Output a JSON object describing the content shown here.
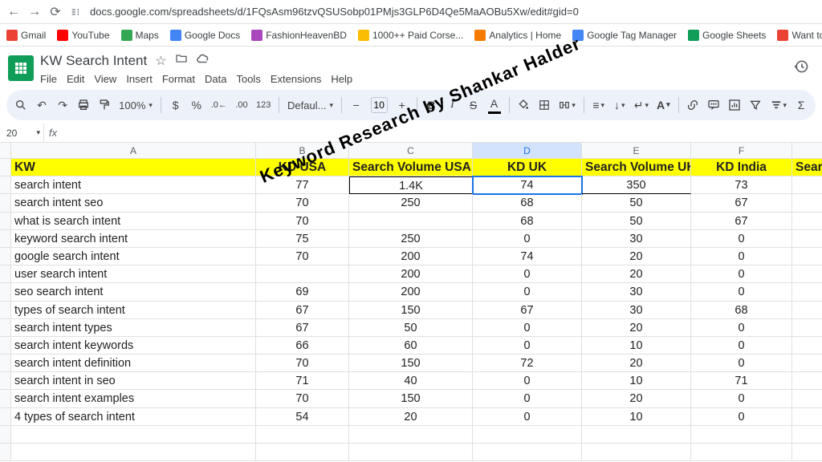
{
  "browser": {
    "url": "docs.google.com/spreadsheets/d/1FQsAsm96tzvQSUSobp01PMjs3GLP6D4Qe5MaAOBu5Xw/edit#gid=0"
  },
  "bookmarks": [
    {
      "label": "Gmail",
      "color": "#ea4335"
    },
    {
      "label": "YouTube",
      "color": "#ff0000"
    },
    {
      "label": "Maps",
      "color": "#34a853"
    },
    {
      "label": "Google Docs",
      "color": "#4285f4"
    },
    {
      "label": "FashionHeavenBD",
      "color": "#ab47bc"
    },
    {
      "label": "1000++ Paid Corse...",
      "color": "#fbbc04"
    },
    {
      "label": "Analytics | Home",
      "color": "#f57c00"
    },
    {
      "label": "Google Tag Manager",
      "color": "#4285f4"
    },
    {
      "label": "Google Sheets",
      "color": "#0f9d58"
    },
    {
      "label": "Want to be a top rat...",
      "color": "#ea4335"
    }
  ],
  "doc": {
    "title": "KW Search Intent",
    "menus": [
      "File",
      "Edit",
      "View",
      "Insert",
      "Format",
      "Data",
      "Tools",
      "Extensions",
      "Help"
    ]
  },
  "toolbar": {
    "zoom": "100%",
    "font": "Defaul...",
    "size": "10"
  },
  "namebox": "20",
  "columns": [
    "",
    "A",
    "B",
    "C",
    "D",
    "E",
    "F",
    ""
  ],
  "header_row": [
    "KW",
    "KD  USA",
    "Search Volume USA",
    "KD UK",
    "Search Volume UK",
    "KD India",
    "Search Vo"
  ],
  "rows": [
    {
      "kw": "search intent",
      "b": "77",
      "c": "1.4K",
      "d": "74",
      "e": "350",
      "f": "73"
    },
    {
      "kw": "search intent seo",
      "b": "70",
      "c": "250",
      "d": "68",
      "e": "50",
      "f": "67"
    },
    {
      "kw": "what is search intent",
      "b": "70",
      "c": "",
      "d": "68",
      "e": "50",
      "f": "67"
    },
    {
      "kw": "keyword search intent",
      "b": "75",
      "c": "250",
      "d": "0",
      "e": "30",
      "f": "0"
    },
    {
      "kw": "google search intent",
      "b": "70",
      "c": "200",
      "d": "74",
      "e": "20",
      "f": "0"
    },
    {
      "kw": "user search intent",
      "b": "",
      "c": "200",
      "d": "0",
      "e": "20",
      "f": "0"
    },
    {
      "kw": "seo search intent",
      "b": "69",
      "c": "200",
      "d": "0",
      "e": "30",
      "f": "0"
    },
    {
      "kw": "types of search intent",
      "b": "67",
      "c": "150",
      "d": "67",
      "e": "30",
      "f": "68"
    },
    {
      "kw": "search intent types",
      "b": "67",
      "c": "50",
      "d": "0",
      "e": "20",
      "f": "0"
    },
    {
      "kw": "search intent keywords",
      "b": "66",
      "c": "60",
      "d": "0",
      "e": "10",
      "f": "0"
    },
    {
      "kw": "search intent definition",
      "b": "70",
      "c": "150",
      "d": "72",
      "e": "20",
      "f": "0"
    },
    {
      "kw": "search intent in seo",
      "b": "71",
      "c": "40",
      "d": "0",
      "e": "10",
      "f": "71"
    },
    {
      "kw": "search intent examples",
      "b": "70",
      "c": "150",
      "d": "0",
      "e": "20",
      "f": "0"
    },
    {
      "kw": "4 types of search intent",
      "b": "54",
      "c": "20",
      "d": "0",
      "e": "10",
      "f": "0"
    }
  ],
  "watermark": "Keyword Research by Shankar Halder"
}
